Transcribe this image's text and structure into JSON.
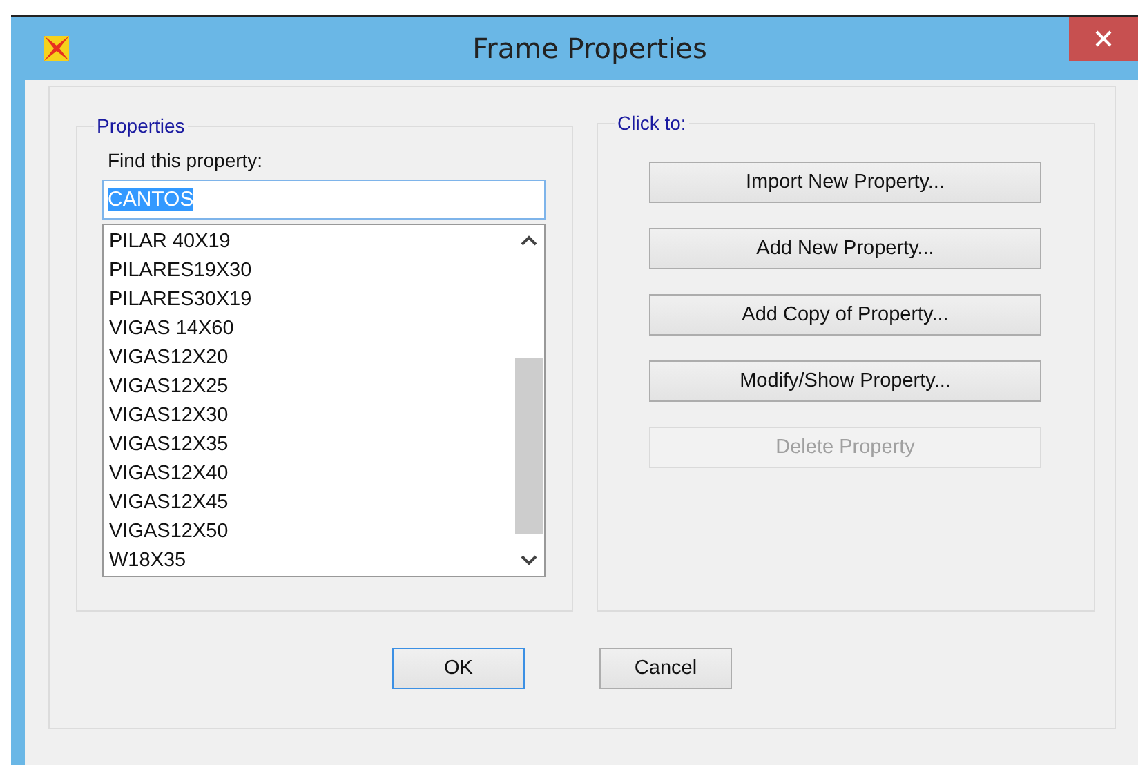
{
  "window": {
    "title": "Frame Properties"
  },
  "properties": {
    "legend": "Properties",
    "find_label": "Find this property:",
    "search": {
      "value": "CANTOS",
      "highlighted": true
    },
    "items": [
      "PILAR 40X19",
      "PILARES19X30",
      "PILARES30X19",
      "VIGAS 14X60",
      "VIGAS12X20",
      "VIGAS12X25",
      "VIGAS12X30",
      "VIGAS12X35",
      "VIGAS12X40",
      "VIGAS12X45",
      "VIGAS12X50",
      "W18X35"
    ]
  },
  "actions": {
    "legend": "Click to:",
    "buttons": [
      {
        "label": "Import New Property...",
        "disabled": false
      },
      {
        "label": "Add New Property...",
        "disabled": false
      },
      {
        "label": "Add Copy of Property...",
        "disabled": false
      },
      {
        "label": "Modify/Show Property...",
        "disabled": false
      },
      {
        "label": "Delete Property",
        "disabled": true
      }
    ]
  },
  "footer": [
    {
      "label": "OK",
      "default": true
    },
    {
      "label": "Cancel",
      "default": false
    }
  ]
}
